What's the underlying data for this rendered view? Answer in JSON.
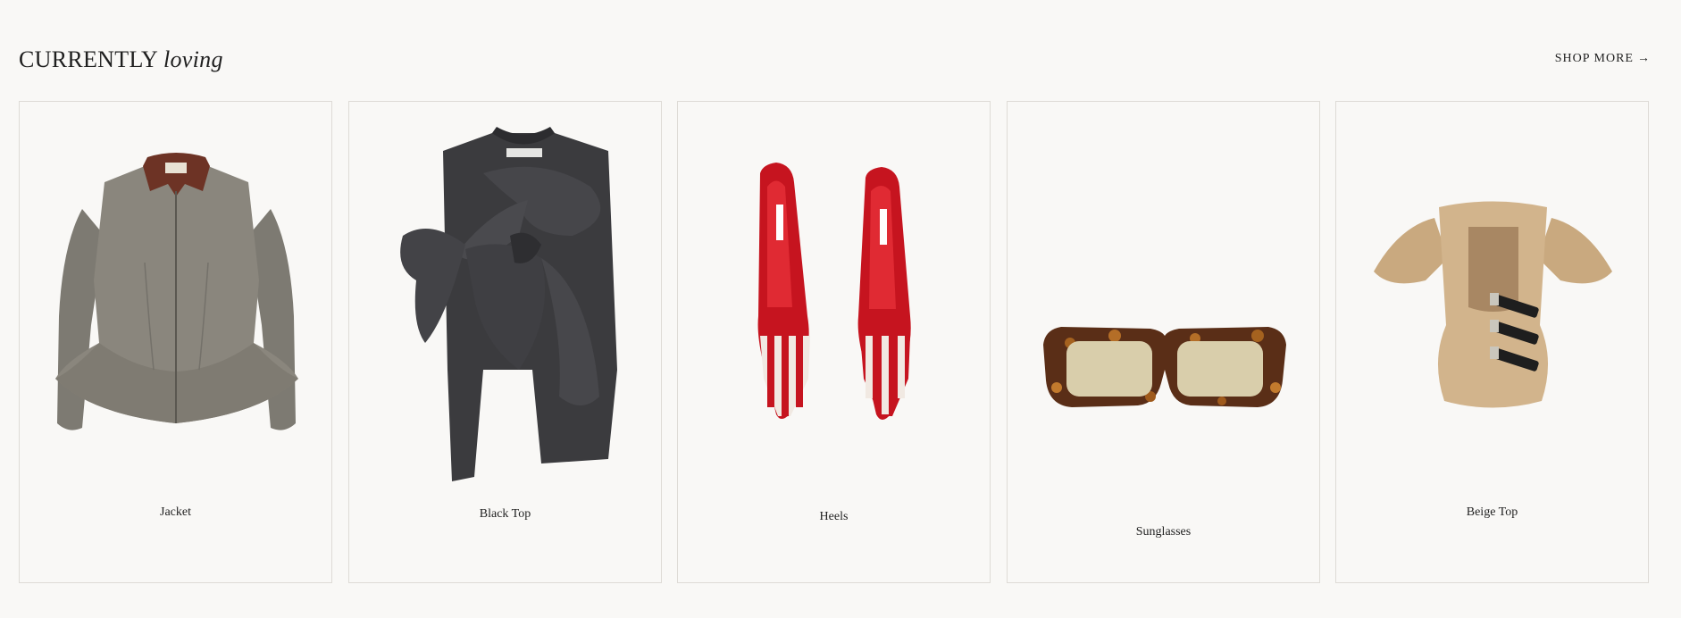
{
  "header": {
    "title_main": "CURRENTLY",
    "title_accent": "loving",
    "shop_more_label": "SHOP MORE",
    "shop_more_arrow": "→"
  },
  "products": [
    {
      "label": "Jacket",
      "image_name": "jacket-image"
    },
    {
      "label": "Black Top",
      "image_name": "black-top-image"
    },
    {
      "label": "Heels",
      "image_name": "heels-image"
    },
    {
      "label": "Sunglasses",
      "image_name": "sunglasses-image"
    },
    {
      "label": "Beige Top",
      "image_name": "beige-top-image"
    }
  ]
}
